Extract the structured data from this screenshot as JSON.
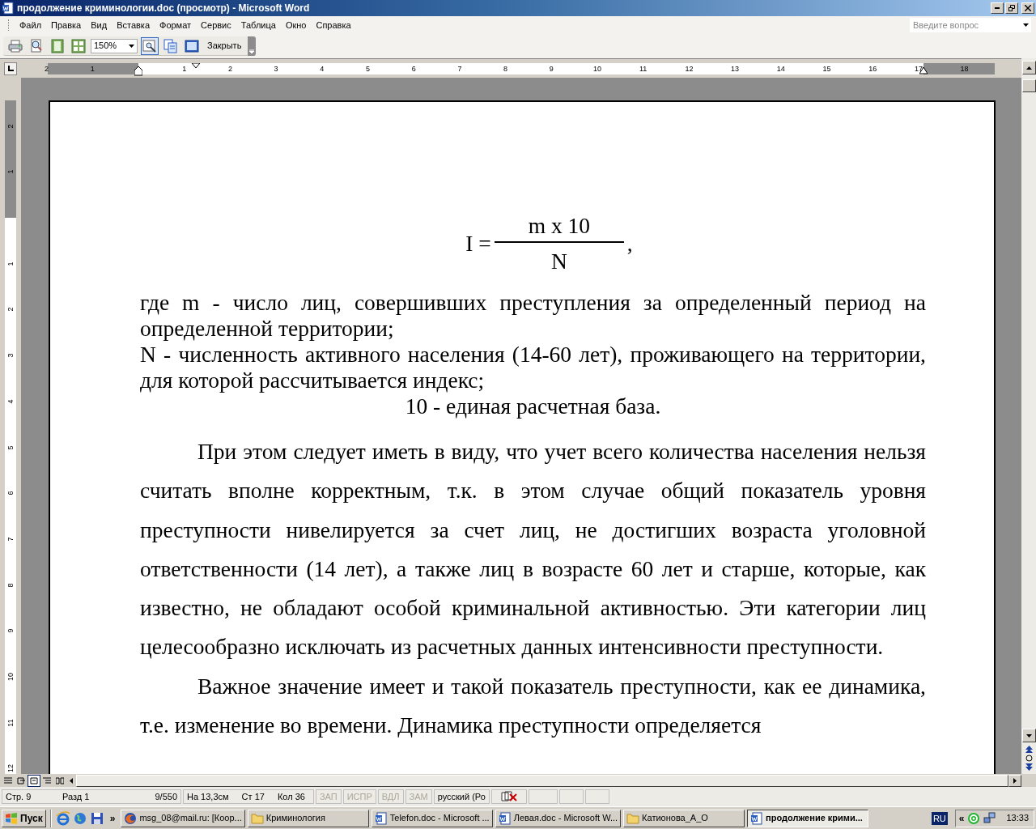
{
  "window": {
    "title": "продолжение криминологии.doc (просмотр) - Microsoft Word"
  },
  "menu": [
    "Файл",
    "Правка",
    "Вид",
    "Вставка",
    "Формат",
    "Сервис",
    "Таблица",
    "Окно",
    "Справка"
  ],
  "help_box": {
    "placeholder": "Введите вопрос"
  },
  "toolbar": {
    "items": [
      {
        "kind": "icon",
        "selected": false
      },
      {
        "kind": "icon",
        "selected": false
      },
      {
        "kind": "icon",
        "selected": false
      },
      {
        "kind": "icon",
        "selected": false
      },
      {
        "kind": "combo",
        "value": "150%"
      },
      {
        "kind": "icon",
        "selected": true
      },
      {
        "kind": "icon",
        "selected": false
      },
      {
        "kind": "icon",
        "selected": false
      },
      {
        "kind": "button",
        "label": "Закрыть"
      }
    ]
  },
  "ruler": {
    "left_labels": [
      "2",
      "1"
    ],
    "labels": [
      "1",
      "2",
      "3",
      "4",
      "5",
      "6",
      "7",
      "8",
      "9",
      "10",
      "11",
      "12",
      "13",
      "14",
      "15",
      "16",
      "17"
    ],
    "right_labels": [
      "18"
    ]
  },
  "vertical_ruler": {
    "top_labels": [
      "2",
      "1"
    ],
    "labels": [
      "1",
      "2",
      "3",
      "4",
      "5",
      "6",
      "7",
      "8",
      "9",
      "10",
      "11",
      "12"
    ]
  },
  "document": {
    "formula": {
      "left": "I =",
      "numerator": "m x 10",
      "denominator": "N",
      "tail": ","
    },
    "definitions": [
      {
        "kind": "justify",
        "text": "где m - число лиц, совершивших преступления за определенный период на определенной территории;"
      },
      {
        "kind": "justify",
        "text": "N - численность активного населения (14-60 лет), проживающего на территории, для которой рассчитывается индекс;"
      },
      {
        "kind": "center",
        "text": "10 - единая расчетная база."
      }
    ],
    "paragraphs": [
      "При этом следует иметь в виду, что учет всего количества населения нельзя считать вполне корректным, т.к. в этом случае общий показатель уровня преступности нивелируется за счет лиц, не достигших возраста уголовной ответственности (14 лет), а также лиц в возрасте 60 лет и старше, которые, как известно, не обладают особой криминальной активностью. Эти категории лиц целесообразно исключать из расчетных данных интенсивности преступности.",
      "Важное значение имеет и такой показатель преступности, как ее динамика, т.е. изменение во времени. Динамика преступности определяется"
    ]
  },
  "view_buttons": [
    {
      "selected": false
    },
    {
      "selected": false
    },
    {
      "selected": true
    },
    {
      "selected": false
    },
    {
      "selected": false
    }
  ],
  "status_bar": {
    "fields": [
      {
        "text": "Стр. 9",
        "disabled": false
      },
      {
        "text": "Разд 1",
        "disabled": false
      },
      {
        "text": "9/550",
        "disabled": false
      },
      {
        "text": "На 13,3см",
        "disabled": false
      },
      {
        "text": "Ст 17",
        "disabled": false
      },
      {
        "text": "Кол 36",
        "disabled": false
      }
    ],
    "modes": [
      {
        "text": "ЗАП",
        "disabled": true
      },
      {
        "text": "ИСПР",
        "disabled": true
      },
      {
        "text": "ВДЛ",
        "disabled": true
      },
      {
        "text": "ЗАМ",
        "disabled": true
      }
    ],
    "language": "русский (Ро"
  },
  "taskbar": {
    "start": "Пуск",
    "more": "»",
    "buttons": [
      {
        "kind": "browser",
        "label": "msg_08@mail.ru: [Коор...",
        "selected": false
      },
      {
        "kind": "folder",
        "label": "Криминология",
        "selected": false
      },
      {
        "kind": "document",
        "label": "Telefon.doc - Microsoft ...",
        "selected": false
      },
      {
        "kind": "document",
        "label": "Левая.doc - Microsoft W...",
        "selected": false
      },
      {
        "kind": "folder",
        "label": "Катионова_А_О",
        "selected": false
      },
      {
        "kind": "document",
        "label": "продолжение крими...",
        "selected": true
      }
    ],
    "language": "RU",
    "tray_expand": "«",
    "time": "13:33"
  }
}
